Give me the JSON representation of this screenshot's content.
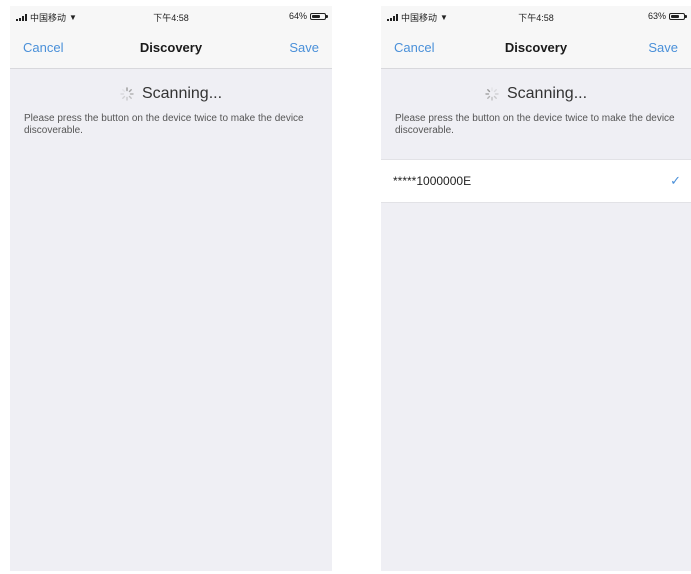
{
  "screens": [
    {
      "status": {
        "carrier": "中国移动",
        "time": "下午4:58",
        "battery": "64%",
        "battery_level": 0.64
      },
      "nav": {
        "cancel_label": "Cancel",
        "title": "Discovery",
        "save_label": "Save"
      },
      "scan_text": "Scanning...",
      "hint": "Please press the button on the device twice to make the device discoverable.",
      "devices": []
    },
    {
      "status": {
        "carrier": "中国移动",
        "time": "下午4:58",
        "battery": "63%",
        "battery_level": 0.63
      },
      "nav": {
        "cancel_label": "Cancel",
        "title": "Discovery",
        "save_label": "Save"
      },
      "scan_text": "Scanning...",
      "hint": "Please press the button on the device twice to make the device discoverable.",
      "devices": [
        {
          "name": "*****1000000E",
          "selected": true
        }
      ]
    }
  ],
  "colors": {
    "accent": "#4a90d9",
    "background": "#efeff4",
    "navbar": "#f7f7f7"
  },
  "icons": {
    "spinner": "spinner-icon",
    "wifi": "wifi-icon",
    "battery": "battery-icon",
    "check": "checkmark-icon"
  }
}
